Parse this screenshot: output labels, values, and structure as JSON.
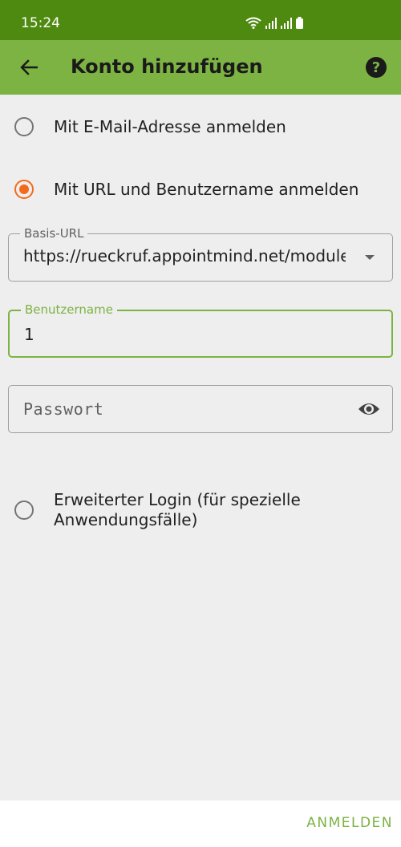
{
  "status_bar": {
    "time": "15:24"
  },
  "app_bar": {
    "title": "Konto hinzufügen"
  },
  "login_options": {
    "email_label": "Mit E-Mail-Adresse anmelden",
    "url_label": "Mit URL und Benutzername anmelden",
    "advanced_label_line1": "Erweiterter Login (für spezielle",
    "advanced_label_line2": "Anwendungsfälle)",
    "selected": "url"
  },
  "fields": {
    "base_url": {
      "label": "Basis-URL",
      "value": "https://rueckruf.appointmind.net/modules"
    },
    "username": {
      "label": "Benutzername",
      "value": "1"
    },
    "password": {
      "placeholder": "Passwort"
    }
  },
  "actions": {
    "login_label": "ANMELDEN"
  },
  "colors": {
    "status_bar": "#4f8a10",
    "app_bar": "#7cb342",
    "accent_radio": "#f26b1d",
    "accent_text": "#7cb342"
  }
}
